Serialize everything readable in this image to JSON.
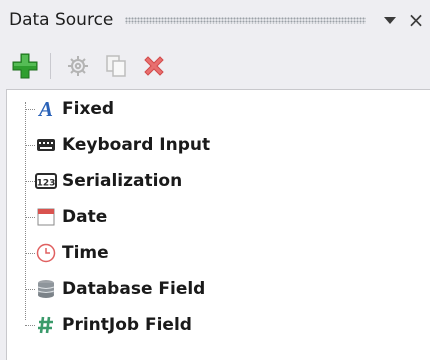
{
  "panel": {
    "title": "Data Source",
    "dropdown_icon": "chevron-down-icon",
    "close_label": "×"
  },
  "toolbar": {
    "add_icon": "plus-icon",
    "settings_icon": "gear-icon",
    "copy_icon": "copy-icon",
    "delete_icon": "delete-icon"
  },
  "tree": {
    "items": [
      {
        "label": "Fixed",
        "icon": "text-a-icon"
      },
      {
        "label": "Keyboard Input",
        "icon": "keyboard-icon"
      },
      {
        "label": "Serialization",
        "icon": "serialization-icon"
      },
      {
        "label": "Date",
        "icon": "calendar-icon"
      },
      {
        "label": "Time",
        "icon": "clock-icon"
      },
      {
        "label": "Database Field",
        "icon": "database-icon"
      },
      {
        "label": "PrintJob Field",
        "icon": "hash-icon"
      }
    ]
  }
}
